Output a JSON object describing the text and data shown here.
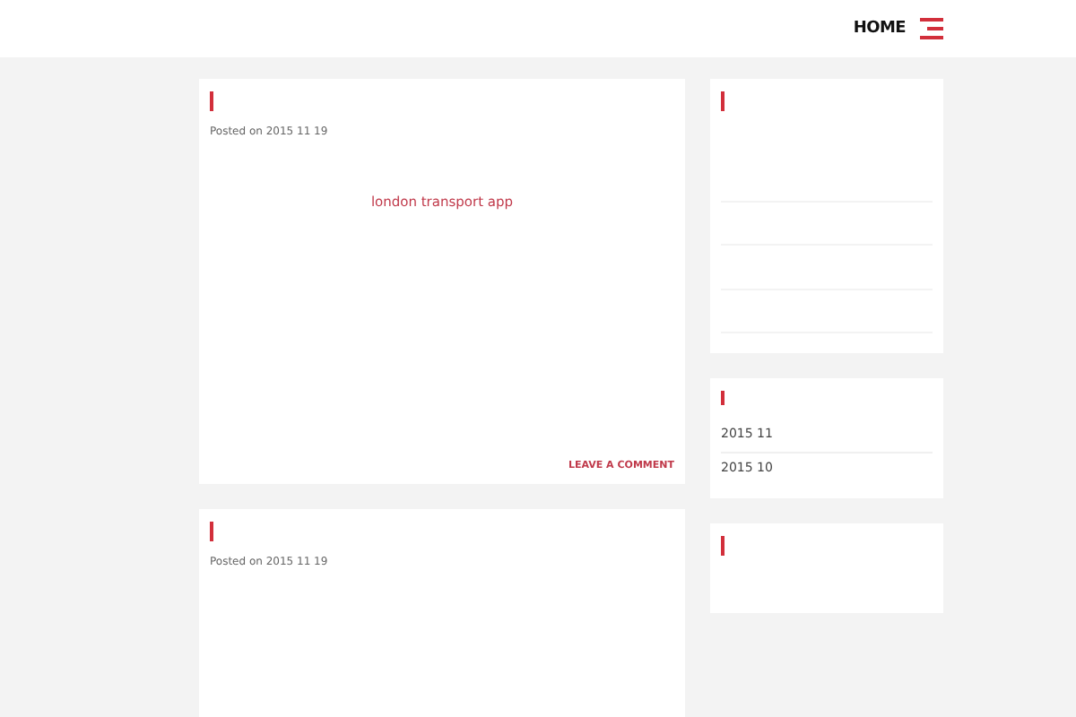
{
  "nav": {
    "home": "HOME"
  },
  "posts": [
    {
      "meta": "Posted on 2015  11  19",
      "body": "london transport app",
      "comment_link": "LEAVE A COMMENT"
    },
    {
      "meta": "Posted on 2015  11  19"
    }
  ],
  "widgets": [
    {
      "kind": "list"
    },
    {
      "kind": "archive",
      "items": [
        "2015  11",
        "2015  10"
      ]
    },
    {
      "kind": "empty"
    }
  ]
}
